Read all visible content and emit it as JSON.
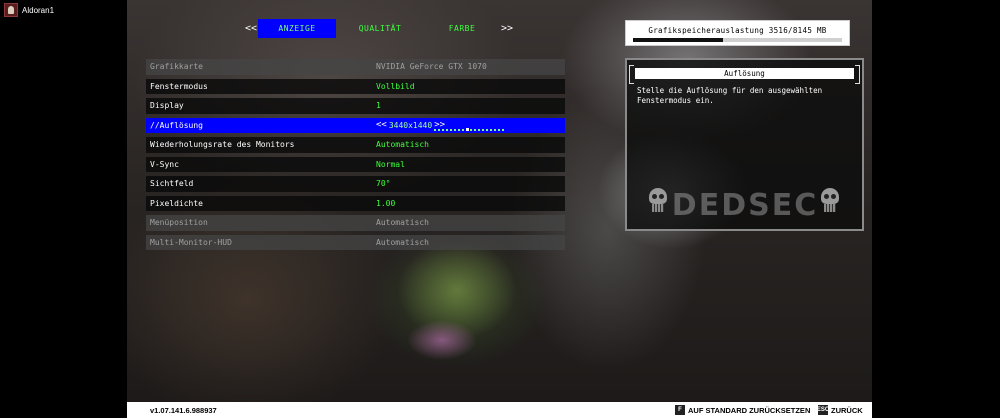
{
  "user": {
    "name": "Aldoran1"
  },
  "tabs": {
    "prev_arrow": "<<",
    "next_arrow": ">>",
    "items": [
      {
        "label": "ANZEIGE",
        "active": true
      },
      {
        "label": "QUALITÄT",
        "active": false
      },
      {
        "label": "FARBE",
        "active": false
      }
    ]
  },
  "vram": {
    "label": "Grafikspeicherauslastung 3516/8145 MB",
    "used_mb": 3516,
    "total_mb": 8145
  },
  "settings": [
    {
      "name": "Grafikkarte",
      "value": "NVIDIA GeForce GTX 1070",
      "state": "disabled"
    },
    {
      "name": "Fenstermodus",
      "value": "Vollbild",
      "state": "normal"
    },
    {
      "name": "Display",
      "value": "1",
      "state": "normal"
    },
    {
      "name": "//Auflösung",
      "value": "3440x1440",
      "state": "selected",
      "left_arrow": "<<",
      "right_arrow": ">>"
    },
    {
      "name": "Wiederholungsrate des Monitors",
      "value": "Automatisch",
      "state": "normal"
    },
    {
      "name": "V-Sync",
      "value": "Normal",
      "state": "normal"
    },
    {
      "name": "Sichtfeld",
      "value": "70°",
      "state": "normal"
    },
    {
      "name": "Pixeldichte",
      "value": "1.00",
      "state": "normal"
    },
    {
      "name": "Menüposition",
      "value": "Automatisch",
      "state": "disabled"
    },
    {
      "name": "Multi-Monitor-HUD",
      "value": "Automatisch",
      "state": "disabled"
    }
  ],
  "info": {
    "title": "Auflösung",
    "description": "Stelle die Auflösung für den ausgewählten Fenstermodus ein.",
    "logo_text": "DEDSEC"
  },
  "footer": {
    "version": "v1.07.141.6.988937",
    "reset_label": "AUF STANDARD ZURÜCKSETZEN",
    "reset_key": "F",
    "back_label": "ZURÜCK",
    "back_key": "ESC"
  }
}
